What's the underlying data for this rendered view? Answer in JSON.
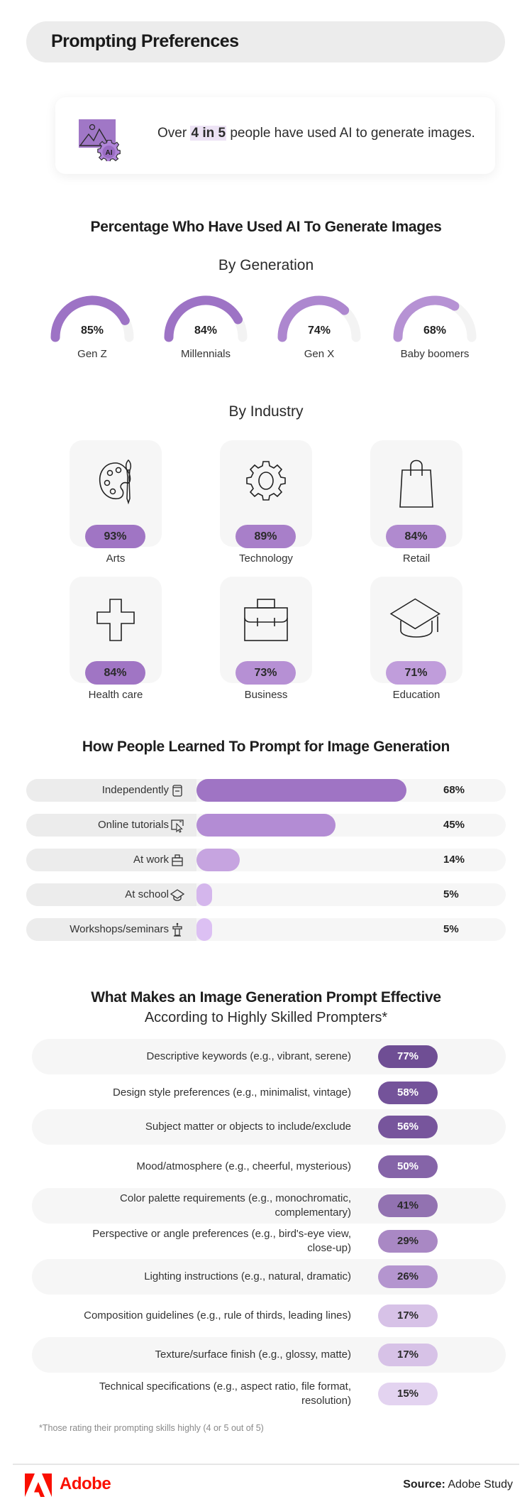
{
  "header": {
    "title": "Prompting Preferences"
  },
  "stat": {
    "prefix": "Over",
    "highlight": "4 in 5",
    "suffix": "people have used AI to generate images.",
    "icon": "ai-image-gear-icon",
    "icon_badge": "AI"
  },
  "generation_section": {
    "title": "Percentage Who Have Used AI To Generate Images",
    "subtitle": "By Generation"
  },
  "industry_section": {
    "subtitle": "By Industry"
  },
  "learn_section": {
    "title": "How People Learned To Prompt for Image Generation"
  },
  "effective_section": {
    "title": "What Makes an Image Generation Prompt Effective",
    "subtitle": "According to Highly Skilled Prompters*",
    "footnote": "*Those rating their prompting skills highly (4 or 5 out of 5)"
  },
  "footer": {
    "brand": "Adobe",
    "source_label": "Source:",
    "source_value": "Adobe Study"
  },
  "colors": {
    "brand_red": "#fa0f00",
    "purple_dark": "#6f4e94",
    "purple_mid": "#a075c4",
    "purple_light": "#d8bdf0",
    "track": "#f3f3f3"
  },
  "chart_data": [
    {
      "type": "gauge",
      "title": "Percentage Who Have Used AI To Generate Images — By Generation",
      "categories": [
        "Gen Z",
        "Millennials",
        "Gen X",
        "Baby boomers"
      ],
      "values": [
        85,
        84,
        74,
        68
      ],
      "labels": [
        "85%",
        "84%",
        "74%",
        "68%"
      ],
      "colors": [
        "#9d73c5",
        "#9d73c5",
        "#ad87cf",
        "#b692d4"
      ],
      "range": [
        0,
        100
      ]
    },
    {
      "type": "table",
      "title": "By Industry",
      "categories": [
        "Arts",
        "Technology",
        "Retail",
        "Health care",
        "Business",
        "Education"
      ],
      "values": [
        93,
        89,
        84,
        84,
        73,
        71
      ],
      "labels": [
        "93%",
        "89%",
        "84%",
        "84%",
        "73%",
        "71%"
      ],
      "icons": [
        "palette-icon",
        "gear-icon",
        "shopping-bag-icon",
        "medical-cross-icon",
        "briefcase-icon",
        "graduation-cap-icon"
      ],
      "colors": [
        "#a075c4",
        "#a87fc9",
        "#b08acf",
        "#a075c4",
        "#b690d4",
        "#c09ddb"
      ]
    },
    {
      "type": "bar",
      "title": "How People Learned To Prompt for Image Generation",
      "categories": [
        "Independently",
        "Online tutorials",
        "At work",
        "At school",
        "Workshops/seminars"
      ],
      "values": [
        68,
        45,
        14,
        5,
        5
      ],
      "labels": [
        "68%",
        "45%",
        "14%",
        "5%",
        "5%"
      ],
      "icons": [
        "book-icon",
        "screen-cursor-icon",
        "briefcase-icon",
        "graduation-cap-icon",
        "podium-icon"
      ],
      "colors": [
        "#9f74c4",
        "#b38cd4",
        "#c6a4e0",
        "#d4b6ec",
        "#dcc0f3"
      ],
      "xlim": [
        0,
        100
      ],
      "orientation": "horizontal"
    },
    {
      "type": "table",
      "title": "What Makes an Image Generation Prompt Effective",
      "subtitle": "According to Highly Skilled Prompters*",
      "categories": [
        "Descriptive keywords (e.g., vibrant, serene)",
        "Design style preferences (e.g., minimalist, vintage)",
        "Subject matter or objects to include/exclude",
        "Mood/atmosphere (e.g., cheerful, mysterious)",
        "Color palette requirements (e.g., monochromatic, complementary)",
        "Perspective or angle preferences (e.g., bird's-eye view, close-up)",
        "Lighting instructions (e.g., natural, dramatic)",
        "Composition guidelines (e.g., rule of thirds, leading lines)",
        "Texture/surface finish (e.g., glossy, matte)",
        "Technical specifications (e.g., aspect ratio, file format, resolution)"
      ],
      "values": [
        77,
        58,
        56,
        50,
        41,
        29,
        26,
        17,
        17,
        15
      ],
      "labels": [
        "77%",
        "58%",
        "56%",
        "50%",
        "41%",
        "29%",
        "26%",
        "17%",
        "17%",
        "15%"
      ],
      "colors": [
        "#6f4e94",
        "#74539a",
        "#77559c",
        "#8564a8",
        "#9272b1",
        "#a988c4",
        "#b495cf",
        "#d7c2e7",
        "#d7c2e7",
        "#e3d3f0"
      ],
      "text_colors": [
        "#ffffff",
        "#ffffff",
        "#ffffff",
        "#ffffff",
        "#2a2a2a",
        "#2a2a2a",
        "#2a2a2a",
        "#2a2a2a",
        "#2a2a2a",
        "#2a2a2a"
      ]
    }
  ]
}
